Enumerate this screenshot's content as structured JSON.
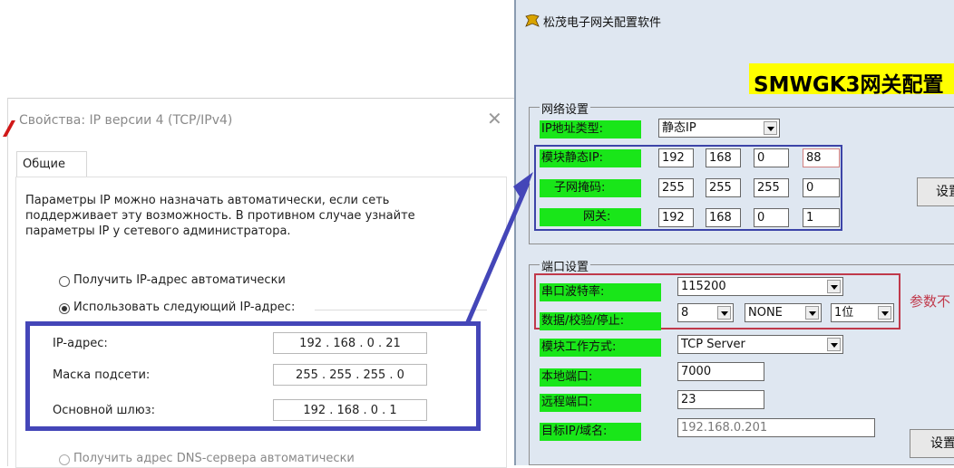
{
  "left_dialog": {
    "title": "Свойства: IP версии 4 (TCP/IPv4)",
    "close_glyph": "✕",
    "tab_general": "Общие",
    "description": "Параметры IP можно назначать автоматически, если сеть поддерживает эту возможность. В противном случае узнайте параметры IP у сетевого администратора.",
    "radio_auto_ip": "Получить IP-адрес автоматически",
    "radio_manual_ip": "Использовать следующий IP-адрес:",
    "ip_label": "IP-адрес:",
    "ip_value": "192 . 168 . 0 . 21",
    "mask_label": "Маска подсети:",
    "mask_value": "255 . 255 . 255 . 0",
    "gateway_label": "Основной шлюз:",
    "gateway_value": "192 . 168 . 0 . 1",
    "radio_auto_dns": "Получить адрес DNS-сервера автоматически"
  },
  "app": {
    "title": "松茂电子网关配置软件",
    "banner": "SMWGK3网关配置",
    "network_group": {
      "title": "网络设置",
      "ip_type_label": "IP地址类型:",
      "ip_type_value": "静态IP",
      "static_ip_label": "模块静态IP:",
      "static_ip": [
        "192",
        "168",
        "0",
        "88"
      ],
      "subnet_label": "子网掩码:",
      "subnet": [
        "255",
        "255",
        "255",
        "0"
      ],
      "gateway_label": "网关:",
      "gateway": [
        "192",
        "168",
        "0",
        "1"
      ],
      "set_button": "设置"
    },
    "port_group": {
      "title": "端口设置",
      "baud_label": "串口波特率:",
      "baud_value": "115200",
      "format_label": "数据/校验/停止:",
      "data_bits": "8",
      "parity": "NONE",
      "stop_bits": "1位",
      "param_note": "参数不",
      "work_mode_label": "模块工作方式:",
      "work_mode_value": "TCP Server",
      "local_port_label": "本地端口:",
      "local_port_value": "7000",
      "remote_port_label": "远程端口:",
      "remote_port_value": "23",
      "target_label": "目标IP/域名:",
      "target_value": "192.168.0.201",
      "set_button": "设置"
    }
  },
  "colors": {
    "annotation_blue": "#4446b8",
    "label_green": "#19e619",
    "banner_yellow": "#ffff00",
    "highlight_red": "#c0394b"
  }
}
